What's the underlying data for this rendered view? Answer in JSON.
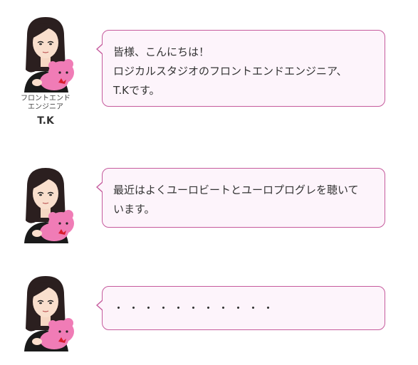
{
  "speaker": {
    "role_line1": "フロントエンド",
    "role_line2": "エンジニア",
    "name": "T.K"
  },
  "messages": [
    {
      "lines": [
        "皆様、こんにちは！",
        "ロジカルスタジオのフロントエンドエンジニア、",
        "T.Kです。"
      ]
    },
    {
      "lines": [
        "最近はよくユーロビートとユーロプログレを聴いて",
        "います。"
      ]
    },
    {
      "lines": [
        "・・・・・・・・・・・"
      ]
    }
  ],
  "colors": {
    "bubble_border": "#c55a9c",
    "bubble_background": "#fdf4fb",
    "text": "#333333"
  },
  "avatar_icon": "avatar-with-pink-bear-icon"
}
